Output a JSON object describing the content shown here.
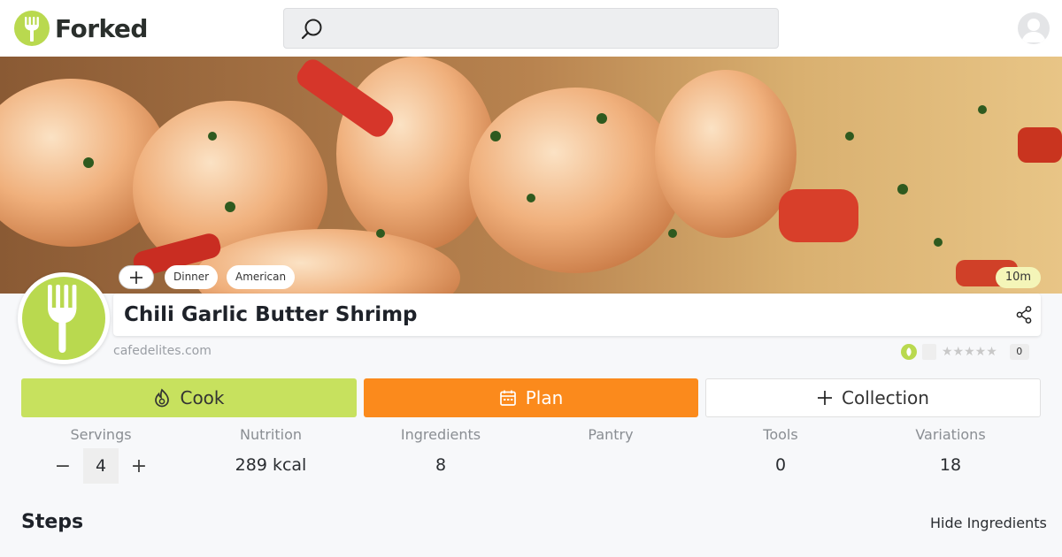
{
  "brand": {
    "name": "Forked",
    "color": "#b9d94f"
  },
  "header": {
    "search_icon": "search-icon",
    "avatar_icon": "user-avatar-icon"
  },
  "recipe": {
    "title": "Chili Garlic Butter Shrimp",
    "source": "cafedelites.com",
    "tags": [
      "Dinner",
      "American"
    ],
    "time": "10m",
    "rating": {
      "stars": 0,
      "max": 5,
      "count": "0"
    }
  },
  "actions": {
    "cook_label": "Cook",
    "plan_label": "Plan",
    "collection_label": "Collection",
    "colors": {
      "cook": "#c7e15e",
      "plan": "#fb8a1c"
    }
  },
  "stats": {
    "servings": {
      "label": "Servings",
      "value": "4",
      "minus": "−",
      "plus": "+"
    },
    "nutrition": {
      "label": "Nutrition",
      "value": "289 kcal"
    },
    "ingredients": {
      "label": "Ingredients",
      "value": "8"
    },
    "pantry": {
      "label": "Pantry",
      "value": ""
    },
    "tools": {
      "label": "Tools",
      "value": "0"
    },
    "variations": {
      "label": "Variations",
      "value": "18"
    }
  },
  "steps": {
    "heading": "Steps",
    "hide_ingredients_label": "Hide Ingredients"
  }
}
